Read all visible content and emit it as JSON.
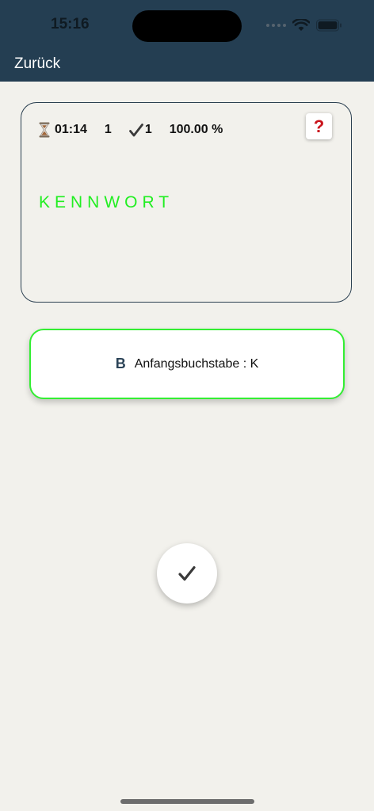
{
  "status_bar": {
    "time": "15:16",
    "icons": [
      "cellular-signal-icon",
      "wifi-icon",
      "battery-icon"
    ]
  },
  "nav": {
    "back_label": "Zurück"
  },
  "card": {
    "timer": "01:14",
    "count": "1",
    "correct": "1",
    "percent": "100.00 %",
    "help_label": "?",
    "word": "KENNWORT"
  },
  "answer": {
    "letter": "B",
    "text": "Anfangsbuchstabe : K"
  },
  "colors": {
    "header": "#243e52",
    "background": "#f2f1ec",
    "accent_green": "#22ee22",
    "help_red": "#c9121a"
  }
}
